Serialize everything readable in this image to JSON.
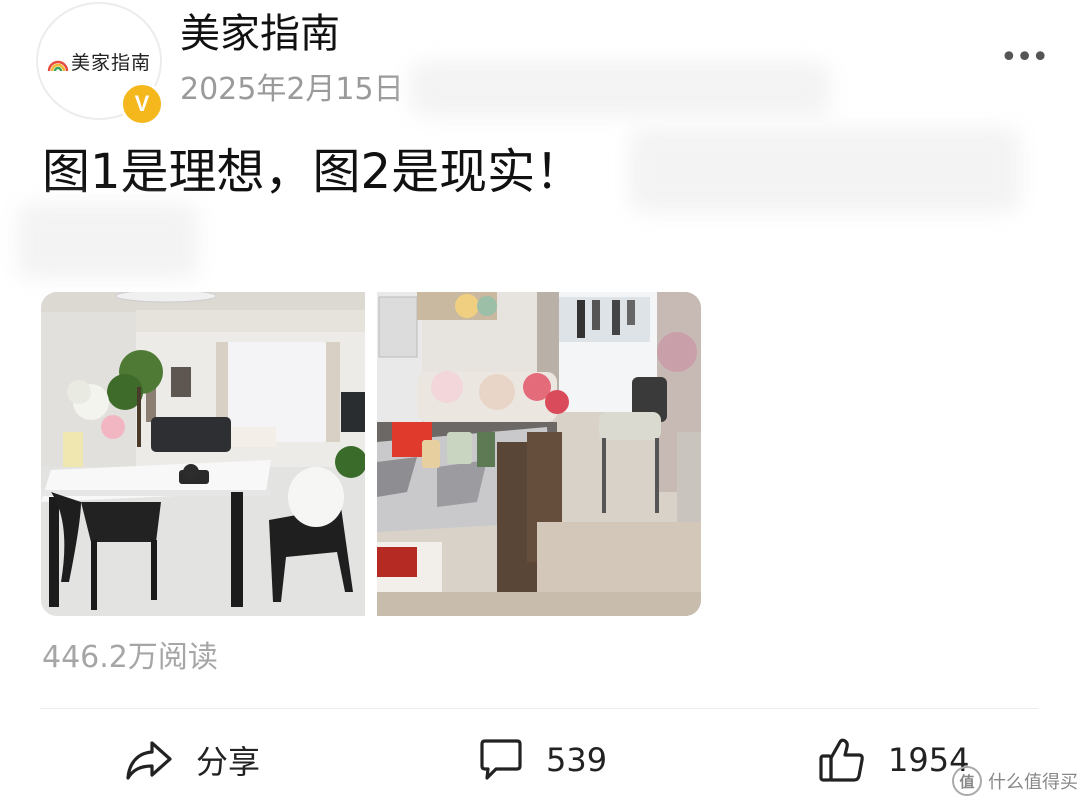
{
  "post": {
    "author": "美家指南",
    "avatar_text": "美家指南",
    "verified_badge": "V",
    "date": "2025年2月15日",
    "text": "图1是理想，图2是现实！",
    "views": "446.2万阅读",
    "more_icon": "•••"
  },
  "actions": {
    "share_label": "分享",
    "comment_count": "539",
    "like_count": "1954"
  },
  "watermark": {
    "icon_text": "值",
    "text": "什么值得买"
  },
  "colors": {
    "verified": "#f5b81c",
    "muted_text": "#9a9a9a",
    "divider": "#ececec"
  }
}
